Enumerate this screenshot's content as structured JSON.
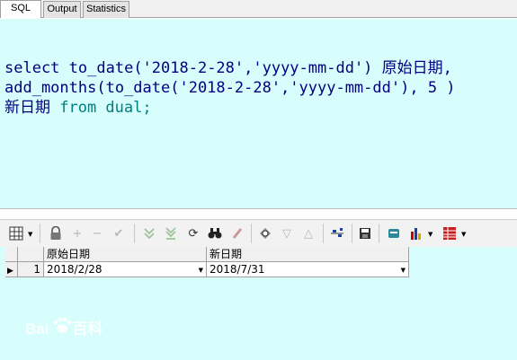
{
  "tabs": [
    {
      "label": "SQL",
      "active": true
    },
    {
      "label": "Output",
      "active": false
    },
    {
      "label": "Statistics",
      "active": false
    }
  ],
  "editor": {
    "line1": {
      "select": "select ",
      "fn": "to_date",
      "args": "('2018-2-28','yyyy-mm-dd') ",
      "alias": "原始日期,"
    },
    "line2": {
      "fn": "add_months",
      "args": "(to_date('2018-2-28','yyyy-mm-dd'), 5 )"
    },
    "line3": {
      "alias": "新日期",
      "from": " from ",
      "table": "dual;"
    }
  },
  "toolbar": {
    "icons": [
      "grid-view-icon",
      "lock-icon",
      "add-record-icon",
      "delete-record-icon",
      "post-icon",
      "next-page-icon",
      "last-page-icon",
      "refresh-icon",
      "find-icon",
      "clear-icon",
      "query-by-example-icon",
      "filter-down-icon",
      "filter-up-icon",
      "connect-icon",
      "save-icon",
      "export-icon",
      "chart-icon",
      "table-options-icon"
    ]
  },
  "grid": {
    "columns": [
      "原始日期",
      "新日期"
    ],
    "rows": [
      {
        "num": "1",
        "values": [
          "2018/2/28",
          "2018/7/31"
        ]
      }
    ]
  },
  "watermark": {
    "text": "Bai",
    "text2": "百科"
  }
}
